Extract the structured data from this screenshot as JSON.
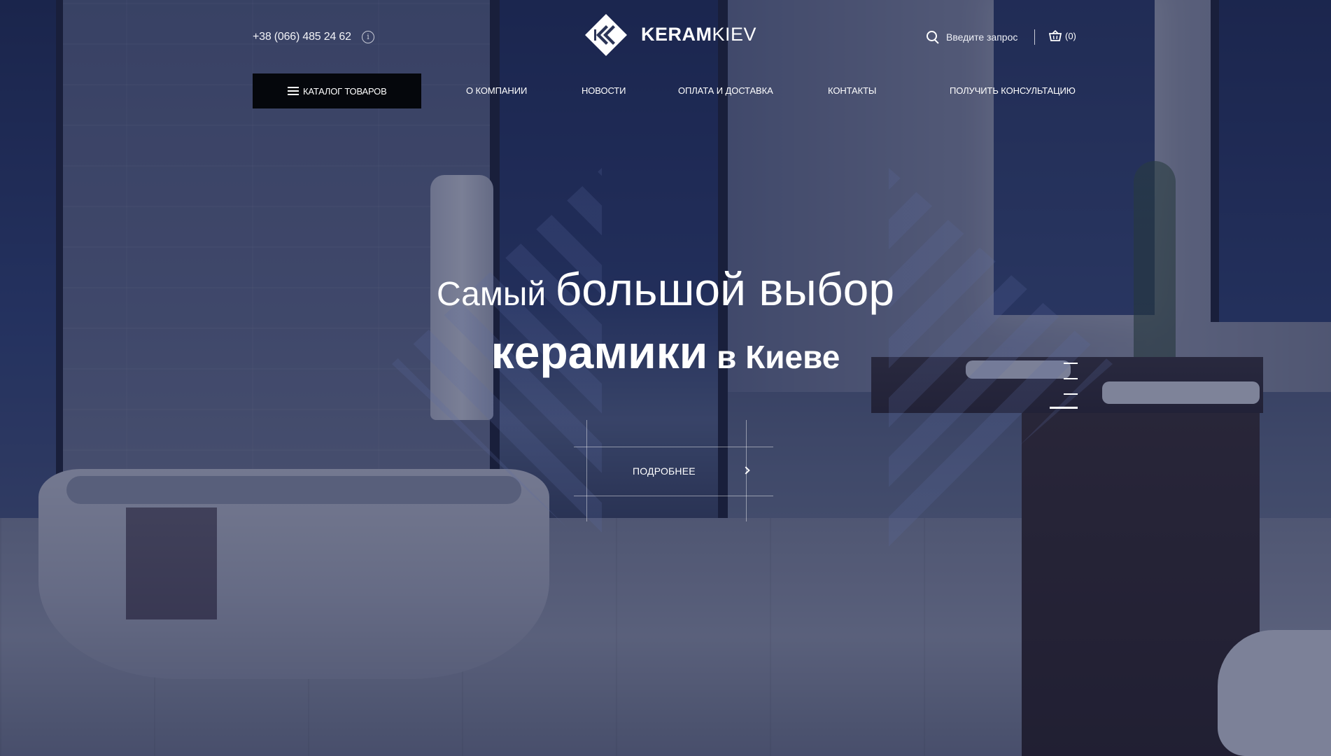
{
  "header": {
    "phone": "+38 (066) 485 24 62",
    "info_icon": "info-icon",
    "logo": {
      "bold": "KERAM",
      "light": "KIEV"
    },
    "search": {
      "placeholder": "Введите запрос"
    },
    "cart": {
      "count_text": "(0)"
    }
  },
  "nav": {
    "catalog_label": "КАТАЛОГ ТОВАРОВ",
    "items": [
      {
        "label": "О КОМПАНИИ"
      },
      {
        "label": "НОВОСТИ"
      },
      {
        "label": "ОПЛАТА И ДОСТАВКА"
      },
      {
        "label": "КОНТАКТЫ"
      },
      {
        "label": "ПОЛУЧИТЬ КОНСУЛЬТАЦИЮ"
      }
    ]
  },
  "hero": {
    "line1_small": "Самый ",
    "line1_big": "большой выбор",
    "line2_big": "керамики",
    "line2_small": " в Киеве",
    "more_label": "ПОДРОБНЕЕ"
  },
  "slider": {
    "slides_count": 4,
    "active_index": 3
  },
  "colors": {
    "overlay": "#19204a",
    "catalog_button_bg": "#05070c",
    "text": "#ffffff"
  }
}
